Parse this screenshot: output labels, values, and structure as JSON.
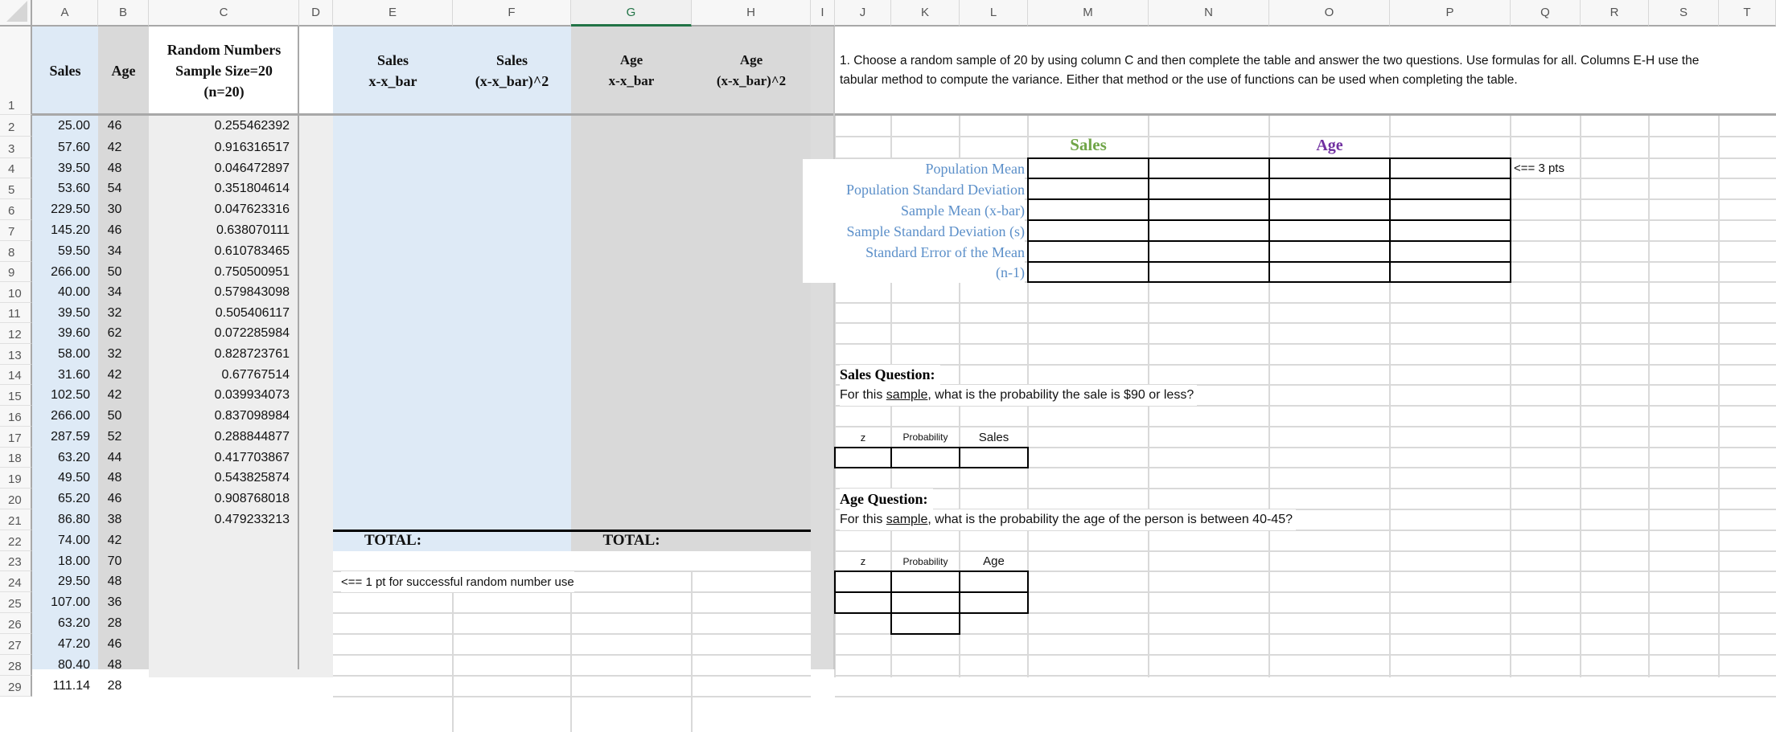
{
  "columns": [
    "A",
    "B",
    "C",
    "D",
    "E",
    "F",
    "G",
    "H",
    "I",
    "J",
    "K",
    "L",
    "M",
    "N",
    "O",
    "P",
    "Q",
    "R",
    "S",
    "T"
  ],
  "selected_column": "G",
  "rows": [
    "1",
    "2",
    "3",
    "4",
    "5",
    "6",
    "7",
    "8",
    "9",
    "10",
    "11",
    "12",
    "13",
    "14",
    "15",
    "16",
    "17",
    "18",
    "19",
    "20",
    "21",
    "22",
    "23",
    "24",
    "25",
    "26",
    "27",
    "28",
    "29"
  ],
  "headers": {
    "sales": "Sales",
    "age": "Age",
    "random": "Random Numbers\nSample Size=20\n(n=20)",
    "e": "Sales\nx-x_bar",
    "f": "Sales\n(x-x_bar)^2",
    "g": "Age\nx-x_bar",
    "h": "Age\n(x-x_bar)^2"
  },
  "data": {
    "sales": [
      "25.00",
      "57.60",
      "39.50",
      "53.60",
      "229.50",
      "145.20",
      "59.50",
      "266.00",
      "40.00",
      "39.50",
      "39.60",
      "58.00",
      "31.60",
      "102.50",
      "266.00",
      "287.59",
      "63.20",
      "49.50",
      "65.20",
      "86.80",
      "74.00",
      "18.00",
      "29.50",
      "107.00",
      "63.20",
      "47.20",
      "80.40",
      "111.14"
    ],
    "age": [
      "46",
      "42",
      "48",
      "54",
      "30",
      "46",
      "34",
      "50",
      "34",
      "32",
      "62",
      "32",
      "42",
      "42",
      "50",
      "52",
      "44",
      "48",
      "46",
      "38",
      "42",
      "70",
      "48",
      "36",
      "28",
      "46",
      "48",
      "28"
    ],
    "random": [
      "0.255462392",
      "0.916316517",
      "0.046472897",
      "0.351804614",
      "0.047623316",
      "0.638070111",
      "0.610783465",
      "0.750500951",
      "0.579843098",
      "0.505406117",
      "0.072285984",
      "0.828723761",
      "0.67767514",
      "0.039934073",
      "0.837098984",
      "0.288844877",
      "0.417703867",
      "0.543825874",
      "0.908768018",
      "0.479233213"
    ]
  },
  "totals": {
    "sales_label": "TOTAL:",
    "age_label": "TOTAL:"
  },
  "note_random": "<== 1 pt for successful random number use",
  "instructions": "1. Choose a random sample of 20 by using column C and then complete the table and answer the two questions. Use formulas for all. Columns E-H use the tabular method to compute the variance. Either that method or the use of functions can be used when completing the table.",
  "stats": {
    "sales_title": "Sales",
    "age_title": "Age",
    "sales_color": "#70a548",
    "age_color": "#7030a0",
    "label_color": "#5b8fc9",
    "labels": [
      "Population Mean",
      "Population Standard Deviation",
      "Sample Mean (x-bar)",
      "Sample Standard Deviation (s)",
      "Standard Error of the Mean",
      "(n-1)"
    ],
    "points_note": "<== 3 pts"
  },
  "sales_question": {
    "title": "Sales Question:",
    "prefix": "For this ",
    "underlined": "sample",
    "suffix": ", what is the probability the sale is $90 or less?",
    "cols": [
      "z",
      "Probability",
      "Sales"
    ]
  },
  "age_question": {
    "title": "Age Question:",
    "prefix": "For this ",
    "underlined": "sample",
    "suffix": ", what is the probability the age of the person is between 40-45?",
    "cols": [
      "z",
      "Probability",
      "Age"
    ]
  }
}
